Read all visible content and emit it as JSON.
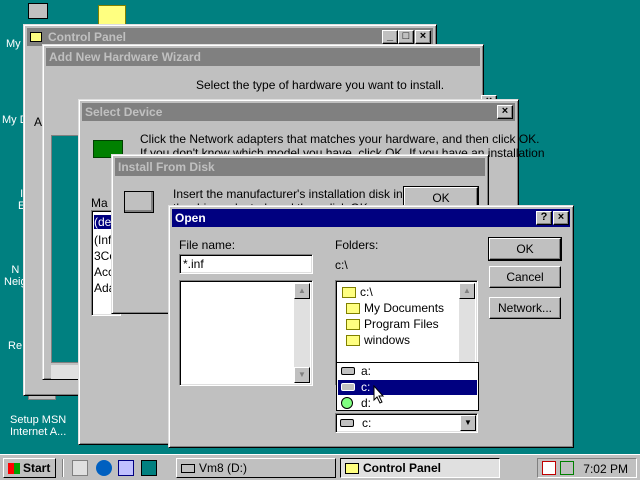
{
  "desktop": {
    "icons": [
      {
        "label": "My"
      },
      {
        "label": "My D"
      },
      {
        "label": "I\nE"
      },
      {
        "label": "N\nNeig"
      },
      {
        "label": "Re"
      },
      {
        "label": "Setup MSN\nInternet A..."
      }
    ]
  },
  "control_panel": {
    "title": "Control Panel",
    "left_tab": "A"
  },
  "wizard": {
    "title": "Add New Hardware Wizard",
    "instruction": "Select the type of hardware you want to install."
  },
  "select_device": {
    "title": "Select Device",
    "text_line1": "Click the Network adapters that matches your hardware, and then click OK.",
    "text_line2": "If you don't know which model you have, click OK. If you have an installation",
    "manufacturers_label": "Ma",
    "list": [
      "(de",
      "(Inf",
      "3Co",
      "Acc",
      "Ada"
    ]
  },
  "install_from_disk": {
    "title": "Install From Disk",
    "text_line1": "Insert the manufacturer's installation disk into",
    "text_line2": "the drive selected, and then click OK.",
    "ok": "OK"
  },
  "open_dialog": {
    "title": "Open",
    "help_btn": "?",
    "close_btn": "×",
    "file_name_label": "File name:",
    "file_name_value": "*.inf",
    "folders_label": "Folders:",
    "current_path": "c:\\",
    "folder_items": [
      "c:\\",
      "My Documents",
      "Program Files",
      "windows"
    ],
    "ok": "OK",
    "cancel": "Cancel",
    "network": "Network...",
    "drive_options": [
      "a:",
      "c:",
      "d:"
    ],
    "selected_drive": "c:",
    "drives_value": "c:"
  },
  "taskbar": {
    "start": "Start",
    "items": [
      "Vm8 (D:)",
      "Control Panel"
    ],
    "time": "7:02 PM"
  },
  "colors": {
    "desktop": "#008080",
    "title_active": "#000080",
    "title_inactive": "#808080",
    "face": "#c0c0c0"
  }
}
